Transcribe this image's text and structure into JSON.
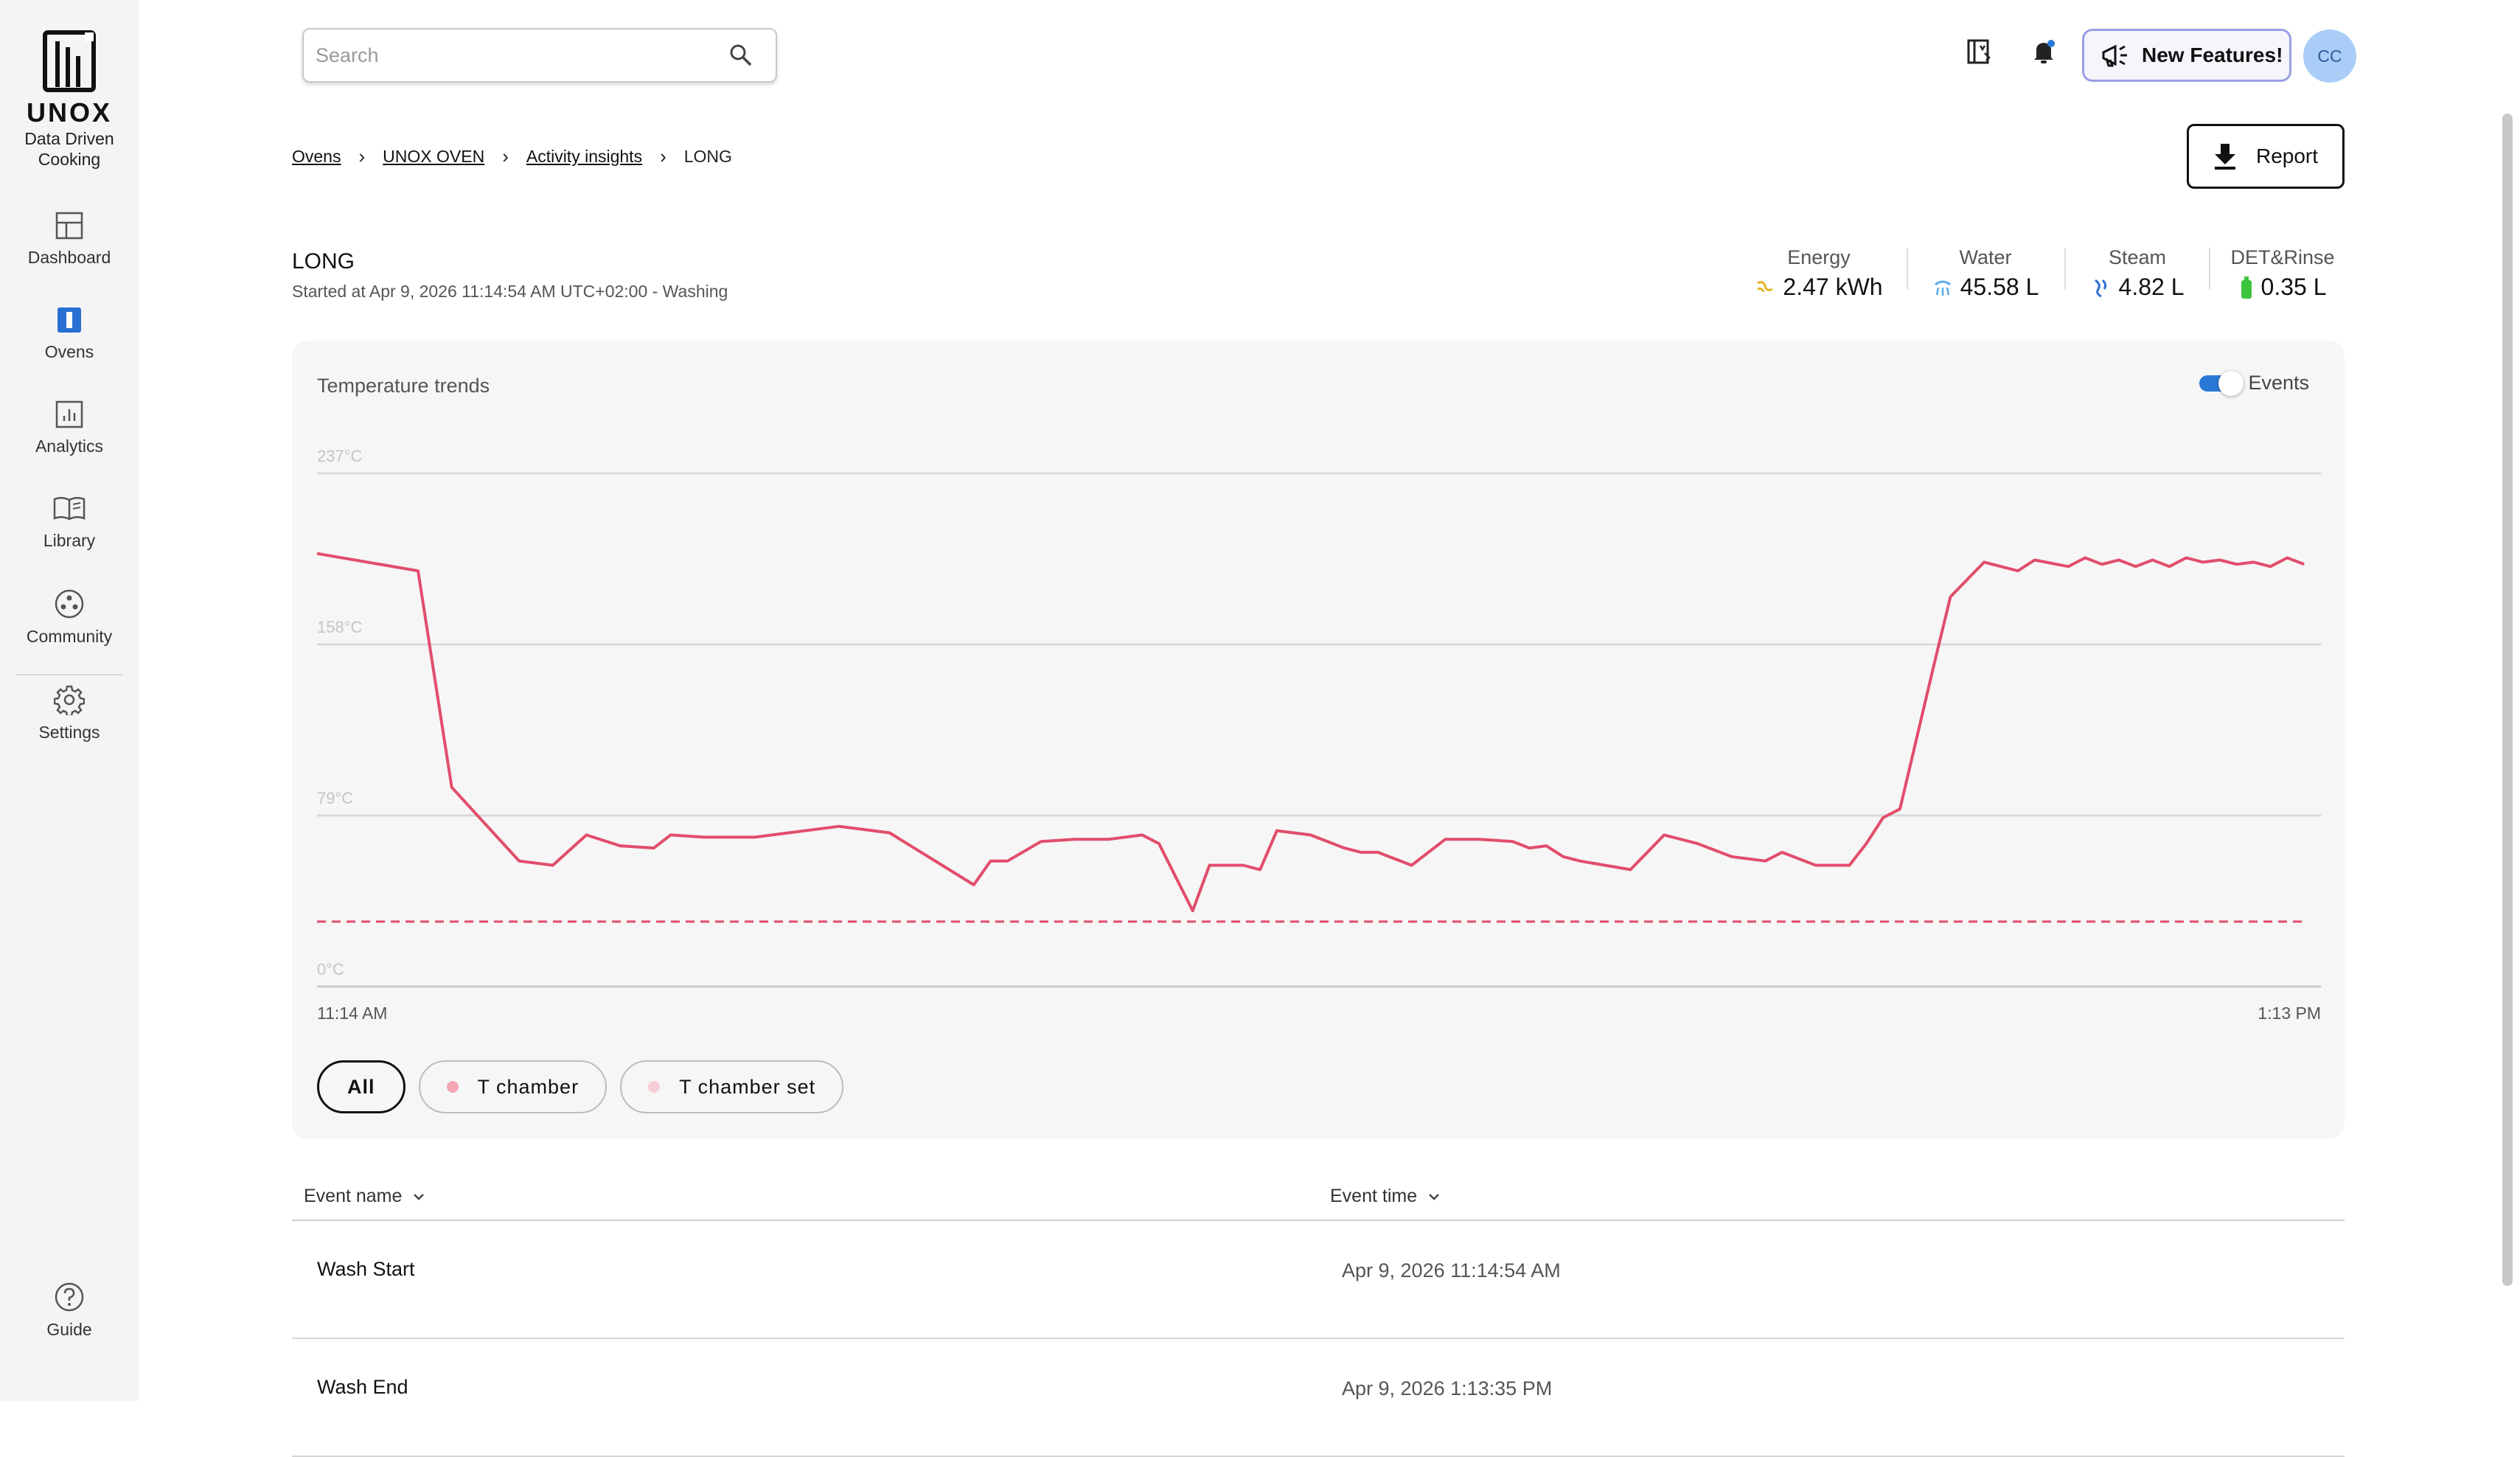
{
  "brand": {
    "name": "UNOX",
    "tagline_line1": "Data Driven",
    "tagline_line2": "Cooking",
    "icon": "unox-logo-icon"
  },
  "sidebar": {
    "items": [
      {
        "label": "Dashboard",
        "icon": "dashboard-icon"
      },
      {
        "label": "Ovens",
        "icon": "oven-icon"
      },
      {
        "label": "Analytics",
        "icon": "analytics-icon"
      },
      {
        "label": "Library",
        "icon": "book-icon"
      },
      {
        "label": "Community",
        "icon": "community-icon"
      },
      {
        "label": "Settings",
        "icon": "gear-icon"
      }
    ],
    "guide": {
      "label": "Guide",
      "icon": "help-circle-icon"
    }
  },
  "topbar": {
    "search_placeholder": "Search",
    "new_features_label": "New Features!",
    "avatar_initials": "CC"
  },
  "breadcrumb": {
    "items": [
      "Ovens",
      "UNOX OVEN",
      "Activity insights"
    ],
    "current": "LONG"
  },
  "report_label": "Report",
  "activity": {
    "title": "LONG",
    "subtitle": "Started at Apr 9, 2026 11:14:54 AM UTC+02:00 - Washing"
  },
  "stats": [
    {
      "label": "Energy",
      "value": "2.47 kWh",
      "icon": "energy-icon",
      "color": "#e6b422"
    },
    {
      "label": "Water",
      "value": "45.58 L",
      "icon": "water-icon",
      "color": "#5aa8e8"
    },
    {
      "label": "Steam",
      "value": "4.82 L",
      "icon": "steam-icon",
      "color": "#2f6fd1"
    },
    {
      "label": "DET&Rinse",
      "value": "0.35 L",
      "icon": "detergent-icon",
      "color": "#3cc43c"
    }
  ],
  "chart_card": {
    "title": "Temperature trends",
    "events_label": "Events",
    "events_on": true
  },
  "chart_data": {
    "type": "line",
    "ylim": [
      0,
      237
    ],
    "y_ticks": [
      "237°C",
      "158°C",
      "79°C",
      "0°C"
    ],
    "y_tick_values": [
      237,
      158,
      79,
      0
    ],
    "x_tick_labels": [
      "11:14 AM",
      "1:13 PM"
    ],
    "xlim": [
      "11:14 AM",
      "1:13 PM"
    ],
    "grid": true,
    "series": [
      {
        "name": "T chamber",
        "color": "#e24d6c",
        "style": "solid",
        "t_minutes": [
          0,
          6,
          8,
          12,
          14,
          16,
          18,
          20,
          21,
          23,
          26,
          31,
          32,
          34,
          39,
          40,
          41,
          43,
          45,
          47,
          49,
          50,
          52,
          53,
          55,
          56,
          57,
          59,
          61,
          62,
          63,
          65,
          67,
          69,
          71,
          72,
          73,
          74,
          75,
          78,
          80,
          82,
          83,
          84,
          86,
          87,
          89,
          91,
          92,
          93,
          94,
          96,
          97,
          99,
          101,
          102,
          104,
          105,
          106,
          107,
          108,
          109,
          110,
          111,
          112,
          113,
          114,
          115,
          116,
          117,
          118
        ],
        "values": [
          200,
          192,
          92,
          58,
          56,
          70,
          65,
          64,
          70,
          69,
          69,
          74,
          73,
          71,
          47,
          58,
          58,
          67,
          68,
          68,
          70,
          66,
          35,
          56,
          56,
          54,
          72,
          70,
          64,
          62,
          62,
          56,
          68,
          68,
          67,
          64,
          65,
          60,
          58,
          54,
          70,
          66,
          63,
          60,
          58,
          62,
          56,
          56,
          66,
          78,
          82,
          148,
          180,
          196,
          192,
          197,
          194,
          198,
          195,
          197,
          194,
          197,
          194,
          198,
          196,
          197,
          195,
          196,
          194,
          198,
          195
        ]
      },
      {
        "name": "T chamber set",
        "color": "#e24d6c",
        "style": "dashed",
        "values_constant": 30
      }
    ],
    "legend": [
      "All",
      "T chamber",
      "T chamber set"
    ],
    "legend_active": "All",
    "legend_dot_colors": [
      "#f4a6b4",
      "#f8cdd6"
    ]
  },
  "table": {
    "columns": [
      "Event name",
      "Event time"
    ],
    "rows": [
      {
        "name": "Wash Start",
        "time": "Apr 9, 2026 11:14:54 AM"
      },
      {
        "name": "Wash End",
        "time": "Apr 9, 2026 1:13:35 PM"
      }
    ]
  }
}
